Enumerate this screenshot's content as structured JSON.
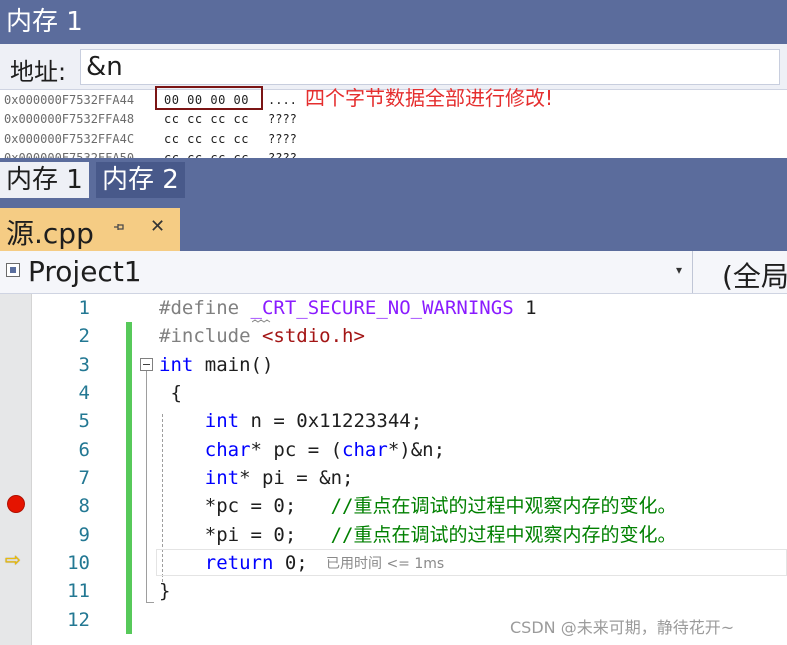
{
  "memory_window": {
    "title": "内存 1",
    "address_label": "地址:",
    "address_value": "&n",
    "rows": [
      {
        "address": "0x000000F7532FFA44",
        "bytes": "00 00 00 00",
        "ascii": "...."
      },
      {
        "address": "0x000000F7532FFA48",
        "bytes": "cc cc cc cc",
        "ascii": "????"
      },
      {
        "address": "0x000000F7532FFA4C",
        "bytes": "cc cc cc cc",
        "ascii": "????"
      },
      {
        "address": "0x000000F7532FFA50",
        "bytes": "cc cc cc cc",
        "ascii": "????"
      }
    ],
    "annotation": "四个字节数据全部进行修改!",
    "annotation_color": "#e52e2e",
    "highlight_color": "#7b1515"
  },
  "memory_tabs": [
    {
      "label": "内存 1",
      "active": true
    },
    {
      "label": "内存 2",
      "active": false
    }
  ],
  "document_tab": {
    "filename": "源.cpp",
    "pin_icon": "pin-icon",
    "close_glyph": "✕"
  },
  "navigation_bar": {
    "project": "Project1",
    "dropdown_glyph": "▾",
    "scope": "(全局"
  },
  "editor": {
    "line_numbers": [
      "1",
      "2",
      "3",
      "4",
      "5",
      "6",
      "7",
      "8",
      "9",
      "10",
      "11",
      "12"
    ],
    "breakpoint_line": 8,
    "current_line": 10,
    "code": {
      "l1_directive": "#define",
      "l1_macro": "_CRT_SECURE_NO_WARNINGS",
      "l1_value": "1",
      "l2_directive": "#include",
      "l2_header": "<stdio.h>",
      "l3_keyword": "int",
      "l3_rest": "main()",
      "l4_text": "{",
      "l5_keyword": "int",
      "l5_rest": "n = 0x11223344;",
      "l6_keyword": "char",
      "l6_mid": "* pc = (",
      "l6_keyword2": "char",
      "l6_rest": "*)&n;",
      "l7_keyword": "int",
      "l7_rest": "* pi = &n;",
      "l8_code": "*pc = 0;   ",
      "l8_comment": "//重点在调试的过程中观察内存的变化。",
      "l9_code": "*pi = 0;   ",
      "l9_comment": "//重点在调试的过程中观察内存的变化。",
      "l10_keyword": "return",
      "l10_rest": "0;",
      "l11_text": "}"
    },
    "elapsed_label": "已用时间 <= 1ms"
  },
  "watermark": "CSDN @未来可期，静待花开~",
  "colors": {
    "toolwindow_header": "#5b6c9c",
    "document_tab": "#f5cc84",
    "keyword": "#0000ff",
    "comment": "#008000",
    "breakpoint": "#e51400",
    "change_bar": "#57c95a"
  }
}
